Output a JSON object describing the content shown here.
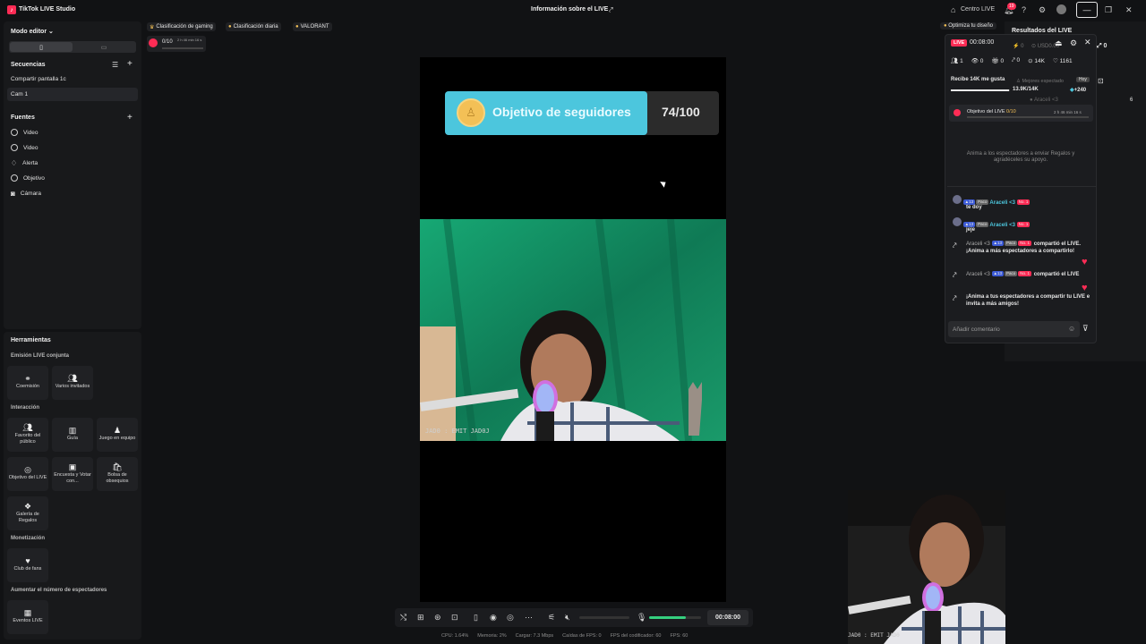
{
  "app": {
    "title": "TikTok LIVE Studio",
    "center_title": "Información sobre el LIVE",
    "centro_live": "Centro LIVE",
    "notif_count": "19"
  },
  "left": {
    "mode": "Modo editor",
    "sequences_title": "Secuencias",
    "sequences": [
      "Compartir pantalla 1c",
      "Cam 1"
    ],
    "sources_title": "Fuentes",
    "sources": [
      "Video",
      "Video",
      "Alerta",
      "Objetivo",
      "Cámara"
    ],
    "tools_title": "Herramientas",
    "sec_coemision": "Emisión LIVE conjunta",
    "tools_a": [
      "Coemisión",
      "Varios invitados"
    ],
    "sec_interaccion": "Interacción",
    "tools_b": [
      "Favorito del público",
      "Guía",
      "Juego en equipo",
      "Objetivo del LIVE",
      "Encuesta y Votar con...",
      "Bolsa de obsequios",
      "Galería de Regalos"
    ],
    "sec_monet": "Monetización",
    "tools_c": [
      "Club de fans"
    ],
    "sec_aumentar": "Aumentar el número de espectadores",
    "tools_d": [
      "Eventos LIVE"
    ]
  },
  "top_chips": [
    "Clasificación de gaming",
    "Clasificación diaria",
    "VALORANT"
  ],
  "mini_goal": {
    "count": "0/10",
    "time": "2 h 46 min 16 s"
  },
  "canvas": {
    "goal_label": "Objetivo de seguidores",
    "goal_value": "74/100",
    "cam_overlay": "JAD0 : EMIT JAD0J"
  },
  "controls": {
    "timer": "00:08:00",
    "volume_fraction": 0.7
  },
  "status": [
    "CPU: 1.64%",
    "Memoria: 2%",
    "Cargar: 7.3 Mbps",
    "Caídas de FPS: 0",
    "FPS del codificador: 60",
    "FPS: 60"
  ],
  "right": {
    "optimize": "Optimiza tu diseño",
    "results": "Resultados del LIVE",
    "live": "LIVE",
    "time": "00:08:00",
    "stat_a": "0",
    "usd": "USD0.00",
    "stat_b": "0",
    "row2": [
      "1",
      "0",
      "0",
      "0",
      "14K",
      "1161"
    ],
    "likes_goal": "Recibe 14K me gusta",
    "likes_value": "13.9K/14K",
    "likes_fraction": 0.99,
    "best_viewers": "Mejores espectado",
    "today": "Hoy",
    "plus": "+240",
    "araceli": "Araceli <3",
    "side_num": "6",
    "goal_live": "Objetivo del LIVE",
    "goal_live_count": "0/10",
    "goal_live_time": "2 h 46 min 16 s",
    "encourage": "Anima a los espectadores a enviar Regalos y agradéceles su apoyo.",
    "comments": [
      {
        "user": "Araceli <3",
        "text": "te doy"
      },
      {
        "user": "Araceli <3",
        "text": "jeje"
      }
    ],
    "share1": "compartió el LIVE. ¡Anima a más espectadores a compartirlo!",
    "share2": "compartió el LIVE",
    "invite": "¡Anima a tus espectadores a compartir tu LIVE e invita a más amigos!",
    "tag_lvl": "13",
    "tag_paco": "Paco",
    "tag_no1": "No. 1",
    "comment_placeholder": "Añadir comentario"
  },
  "pip_overlay": "JAD0 : EMIT JAD0"
}
